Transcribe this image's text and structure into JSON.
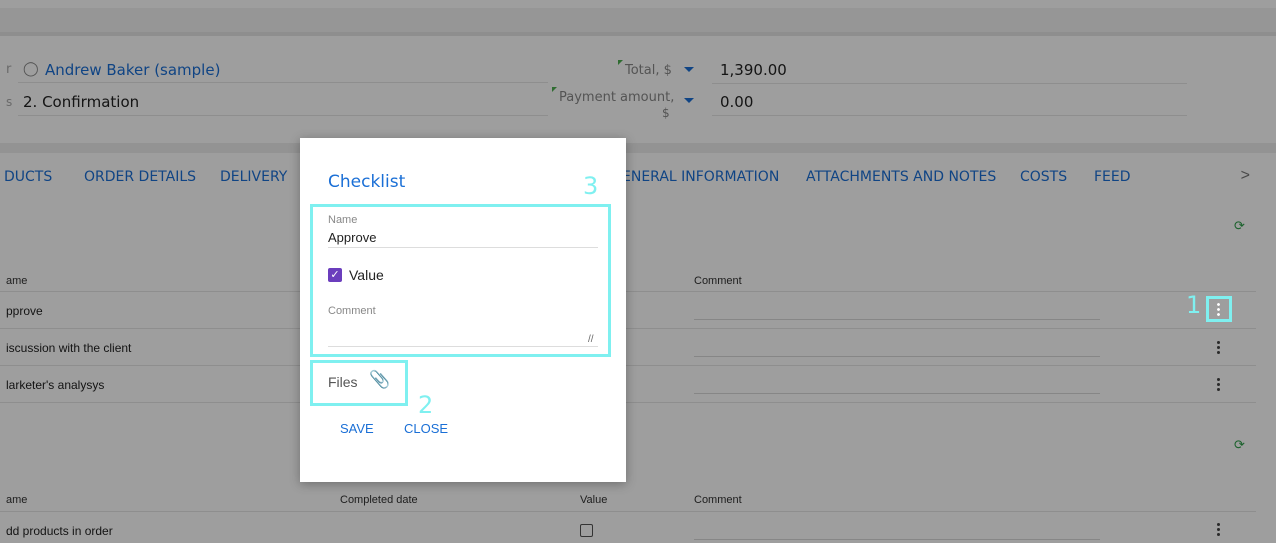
{
  "header": {
    "owner_prefix": "r",
    "owner_name": "Andrew Baker (sample)",
    "stage_prefix": "s",
    "stage_value": "2. Confirmation",
    "total_label": "Total, $",
    "total_value": "1,390.00",
    "payment_label_line1": "Payment amount,",
    "payment_label_line2": "$",
    "payment_value": "0.00"
  },
  "tabs": [
    "DUCTS",
    "ORDER DETAILS",
    "DELIVERY",
    "ENERAL INFORMATION",
    "ATTACHMENTS AND NOTES",
    "COSTS",
    "FEED"
  ],
  "tabs_more": ">",
  "section1": {
    "columns": {
      "name": "ame",
      "comment": "Comment"
    },
    "rows": [
      "pprove",
      "iscussion with the client",
      "larketer's analysys"
    ]
  },
  "section2": {
    "columns": {
      "name": "ame",
      "completed": "Completed date",
      "value": "Value",
      "comment": "Comment"
    },
    "rows": [
      "dd products in order"
    ]
  },
  "modal": {
    "title": "Checklist",
    "name_label": "Name",
    "name_value": "Approve",
    "value_label": "Value",
    "value_checked": true,
    "comment_label": "Comment",
    "files_label": "Files",
    "save_label": "SAVE",
    "close_label": "CLOSE"
  },
  "annotations": [
    "1",
    "2",
    "3"
  ],
  "colors": {
    "accent": "#1a6fd6",
    "annotation": "#7ff0f0",
    "checkbox": "#6b3ebd",
    "refresh": "#2e9e4a"
  },
  "icons": [
    "user-icon",
    "dropdown-icon",
    "refresh-icon",
    "kebab-menu-icon",
    "paperclip-icon",
    "chevron-right-icon",
    "checkbox-icon"
  ]
}
